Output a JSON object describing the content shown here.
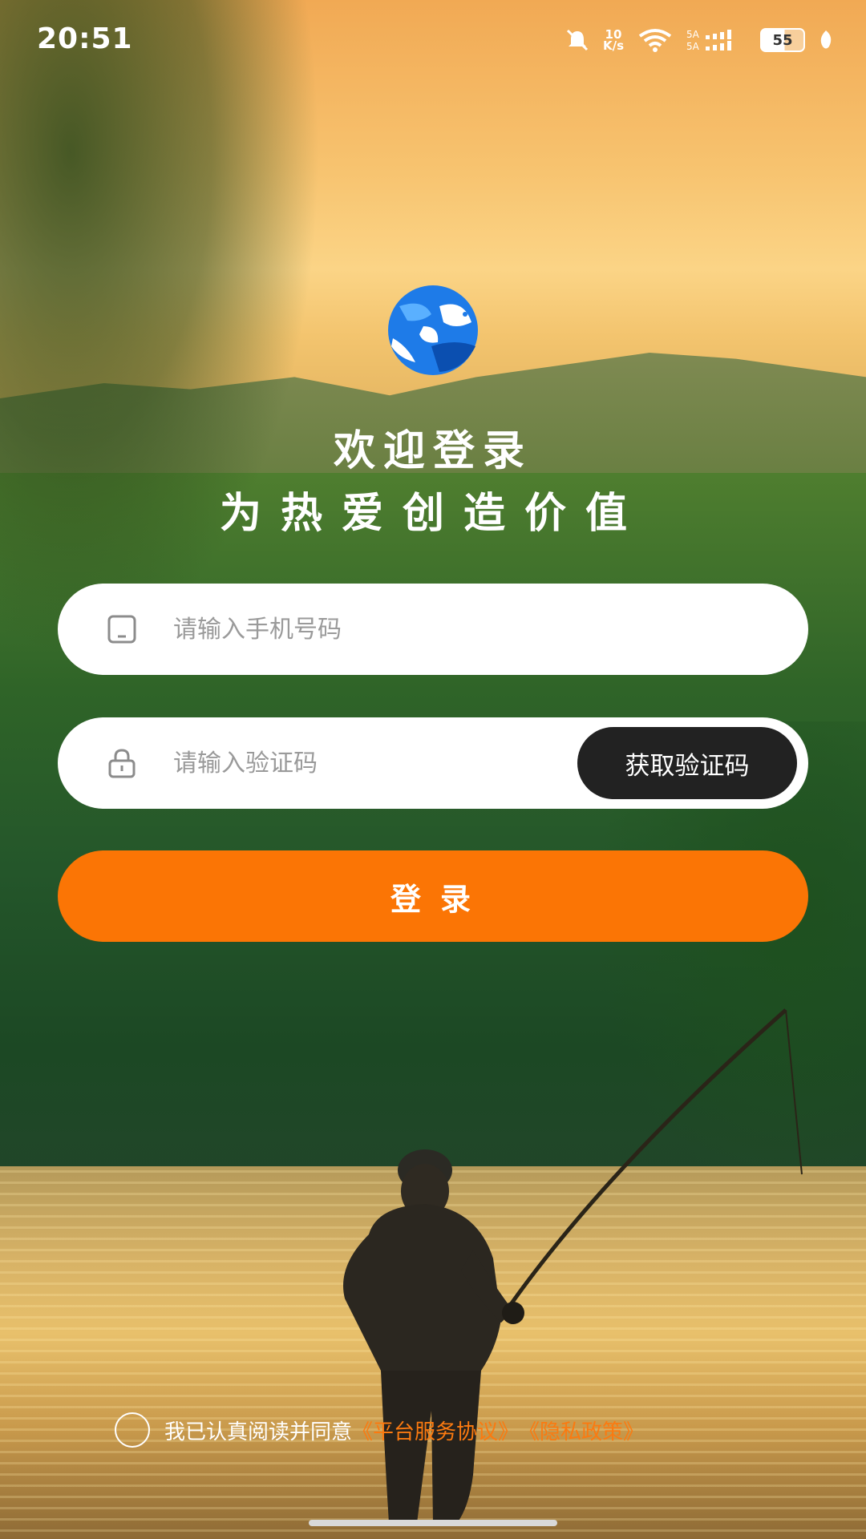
{
  "status_bar": {
    "time": "20:51",
    "net_speed_value": "10",
    "net_speed_unit": "K/s",
    "battery": "55",
    "icons": [
      "mute-icon",
      "wifi-icon",
      "signal-icon",
      "battery-icon",
      "leaf-icon"
    ]
  },
  "login": {
    "welcome_title": "欢迎登录",
    "slogan": "为热爱创造价值",
    "phone_placeholder": "请输入手机号码",
    "code_placeholder": "请输入验证码",
    "get_code_label": "获取验证码",
    "login_label": "登录"
  },
  "agreement": {
    "prefix": "我已认真阅读并同意",
    "service_link": "《平台服务协议》",
    "privacy_link": "《隐私政策》",
    "checked": false
  },
  "colors": {
    "accent": "#fb7505",
    "dark_button": "#222222",
    "link": "#fb7a10"
  }
}
